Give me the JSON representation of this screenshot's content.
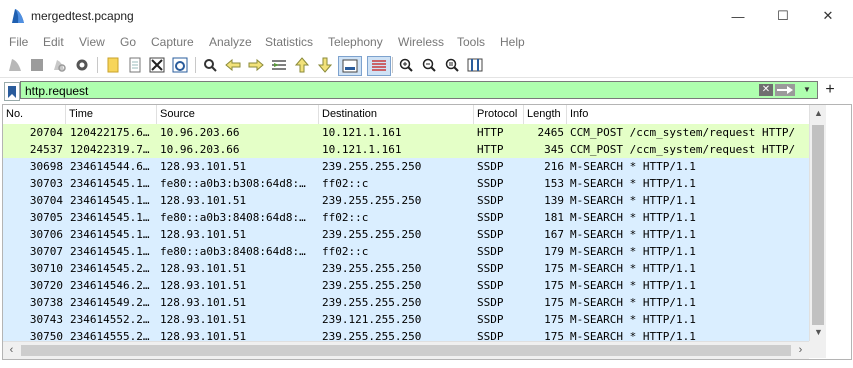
{
  "window": {
    "title": "mergedtest.pcapng",
    "minimize_glyph": "—",
    "maximize_glyph": "☐",
    "close_glyph": "✕"
  },
  "menu": [
    "File",
    "Edit",
    "View",
    "Go",
    "Capture",
    "Analyze",
    "Statistics",
    "Telephony",
    "Wireless",
    "Tools",
    "Help"
  ],
  "toolbar_icons": [
    "start-capture-icon",
    "stop-capture-icon",
    "restart-capture-icon",
    "capture-options-icon",
    "open-file-icon",
    "save-file-icon",
    "close-file-icon",
    "reload-file-icon",
    "find-packet-icon",
    "go-back-icon",
    "go-forward-icon",
    "go-to-packet-icon",
    "go-first-icon",
    "go-last-icon",
    "autoscroll-icon",
    "colorize-icon",
    "zoom-in-icon",
    "zoom-out-icon",
    "normal-size-icon",
    "resize-columns-icon"
  ],
  "filter": {
    "value": "http.request",
    "clear_glyph": "✕",
    "dropdown_glyph": "▼",
    "add_glyph": "+",
    "color_valid": "#afffaf"
  },
  "colors": {
    "http_row": "#e4ffc7",
    "ssdp_row": "#daeeff"
  },
  "columns": [
    "No.",
    "Time",
    "Source",
    "Destination",
    "Protocol",
    "Length",
    "Info"
  ],
  "packets": [
    {
      "no": "20704",
      "time": "120422175.6…",
      "source": "10.96.203.66",
      "destination": "10.121.1.161",
      "protocol": "HTTP",
      "length": "2465",
      "info": "CCM_POST /ccm_system/request HTTP/"
    },
    {
      "no": "24537",
      "time": "120422319.7…",
      "source": "10.96.203.66",
      "destination": "10.121.1.161",
      "protocol": "HTTP",
      "length": "345",
      "info": "CCM_POST /ccm_system/request HTTP/"
    },
    {
      "no": "30698",
      "time": "234614544.6…",
      "source": "128.93.101.51",
      "destination": "239.255.255.250",
      "protocol": "SSDP",
      "length": "216",
      "info": "M-SEARCH * HTTP/1.1"
    },
    {
      "no": "30703",
      "time": "234614545.1…",
      "source": "fe80::a0b3:b308:64d8:…",
      "destination": "ff02::c",
      "protocol": "SSDP",
      "length": "153",
      "info": "M-SEARCH * HTTP/1.1"
    },
    {
      "no": "30704",
      "time": "234614545.1…",
      "source": "128.93.101.51",
      "destination": "239.255.255.250",
      "protocol": "SSDP",
      "length": "139",
      "info": "M-SEARCH * HTTP/1.1"
    },
    {
      "no": "30705",
      "time": "234614545.1…",
      "source": "fe80::a0b3:8408:64d8:…",
      "destination": "ff02::c",
      "protocol": "SSDP",
      "length": "181",
      "info": "M-SEARCH * HTTP/1.1"
    },
    {
      "no": "30706",
      "time": "234614545.1…",
      "source": "128.93.101.51",
      "destination": "239.255.255.250",
      "protocol": "SSDP",
      "length": "167",
      "info": "M-SEARCH * HTTP/1.1"
    },
    {
      "no": "30707",
      "time": "234614545.1…",
      "source": "fe80::a0b3:8408:64d8:…",
      "destination": "ff02::c",
      "protocol": "SSDP",
      "length": "179",
      "info": "M-SEARCH * HTTP/1.1"
    },
    {
      "no": "30710",
      "time": "234614545.2…",
      "source": "128.93.101.51",
      "destination": "239.255.255.250",
      "protocol": "SSDP",
      "length": "175",
      "info": "M-SEARCH * HTTP/1.1"
    },
    {
      "no": "30720",
      "time": "234614546.2…",
      "source": "128.93.101.51",
      "destination": "239.255.255.250",
      "protocol": "SSDP",
      "length": "175",
      "info": "M-SEARCH * HTTP/1.1"
    },
    {
      "no": "30738",
      "time": "234614549.2…",
      "source": "128.93.101.51",
      "destination": "239.255.255.250",
      "protocol": "SSDP",
      "length": "175",
      "info": "M-SEARCH * HTTP/1.1"
    },
    {
      "no": "30743",
      "time": "234614552.2…",
      "source": "128.93.101.51",
      "destination": "239.121.255.250",
      "protocol": "SSDP",
      "length": "175",
      "info": "M-SEARCH * HTTP/1.1"
    },
    {
      "no": "30750",
      "time": "234614555.2…",
      "source": "128.93.101.51",
      "destination": "239.255.255.250",
      "protocol": "SSDP",
      "length": "175",
      "info": "M-SEARCH * HTTP/1.1"
    }
  ]
}
